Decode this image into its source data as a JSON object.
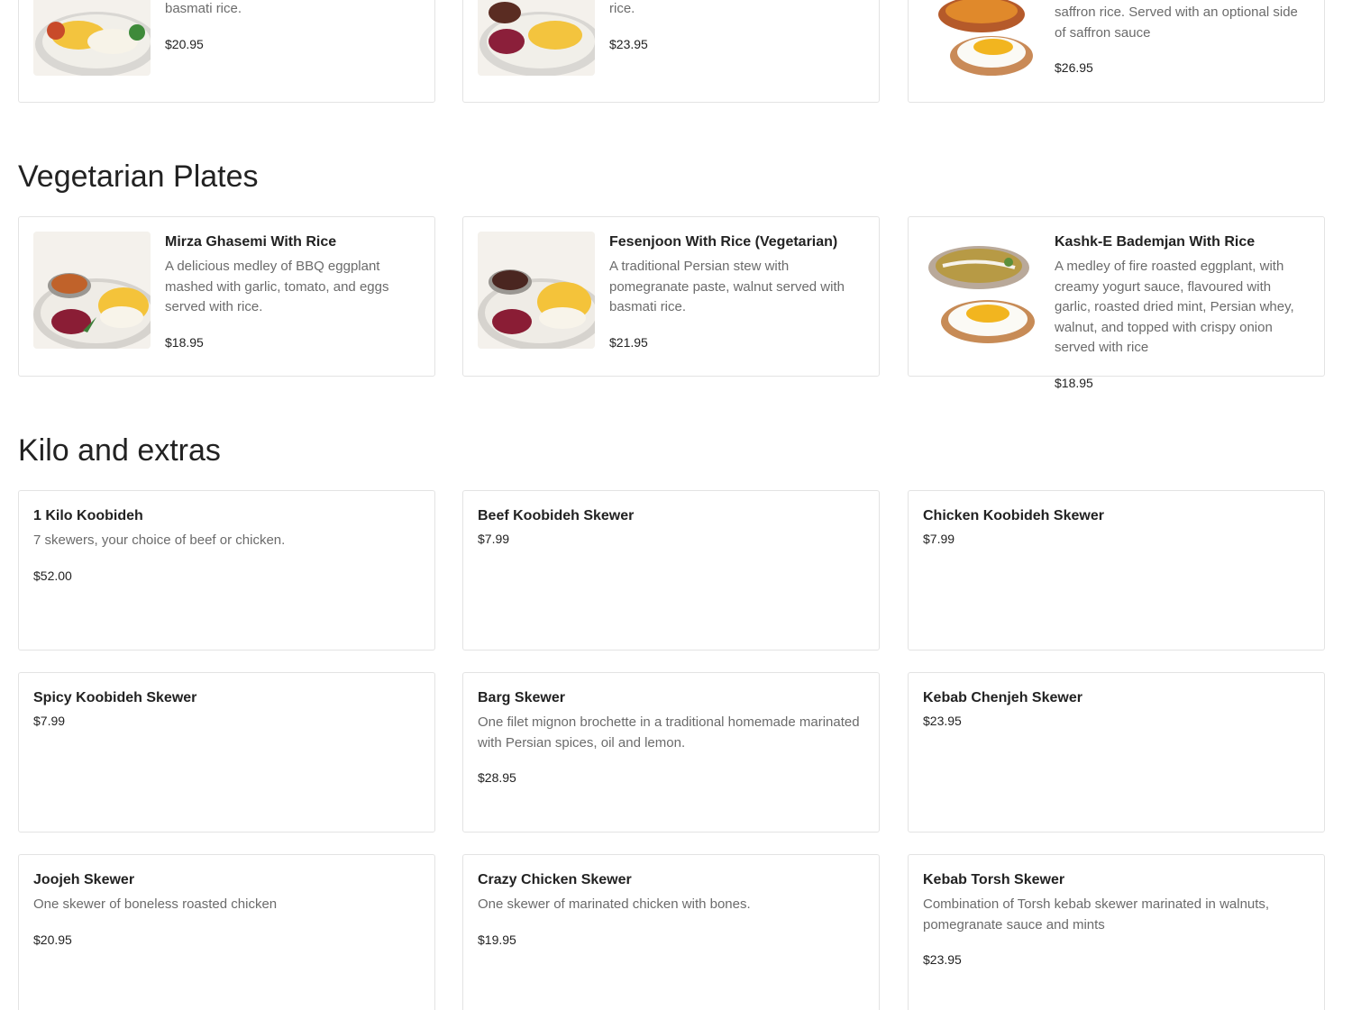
{
  "top_row": [
    {
      "desc": "basmati rice.",
      "price": "$20.95"
    },
    {
      "desc": "pomegranate paste, walnut and in-bone chicken thighs pieces served with basmati rice.",
      "price": "$23.95"
    },
    {
      "desc": "saffron rice. Served with an optional side of saffron sauce",
      "price": "$26.95"
    }
  ],
  "vegetarian": {
    "title": "Vegetarian Plates",
    "items": [
      {
        "name": "Mirza Ghasemi With Rice",
        "desc": "A delicious medley of BBQ eggplant mashed with garlic, tomato, and eggs served with rice.",
        "price": "$18.95",
        "image": "mirza-ghasemi-plate"
      },
      {
        "name": "Fesenjoon With Rice (Vegetarian)",
        "desc": "A traditional Persian stew with pomegranate paste, walnut served with basmati rice.",
        "price": "$21.95",
        "image": "fesenjoon-plate"
      },
      {
        "name": "Kashk-E Bademjan With Rice",
        "desc": "A medley of fire roasted eggplant, with creamy yogurt sauce, flavoured with garlic, roasted dried mint, Persian whey, walnut, and topped with crispy onion served with rice",
        "price": "$18.95",
        "image": "kashk-e-bademjan-plate"
      }
    ]
  },
  "kilo": {
    "title": "Kilo and extras",
    "items": [
      {
        "name": "1 Kilo Koobideh",
        "desc": "7 skewers, your choice of beef or chicken.",
        "price": "$52.00"
      },
      {
        "name": "Beef Koobideh Skewer",
        "desc": "",
        "price": "$7.99"
      },
      {
        "name": "Chicken Koobideh Skewer",
        "desc": "",
        "price": "$7.99"
      },
      {
        "name": "Spicy Koobideh Skewer",
        "desc": "",
        "price": "$7.99"
      },
      {
        "name": "Barg Skewer",
        "desc": "One filet mignon brochette in a traditional homemade marinated with Persian spices, oil and lemon.",
        "price": "$28.95"
      },
      {
        "name": "Kebab Chenjeh Skewer",
        "desc": "",
        "price": "$23.95"
      },
      {
        "name": "Joojeh Skewer",
        "desc": "One skewer of boneless roasted chicken",
        "price": "$20.95"
      },
      {
        "name": "Crazy Chicken Skewer",
        "desc": "One skewer of marinated chicken with bones.",
        "price": "$19.95"
      },
      {
        "name": "Kebab Torsh Skewer",
        "desc": "Combination of Torsh kebab skewer marinated in walnuts, pomegranate sauce and mints",
        "price": "$23.95"
      }
    ]
  }
}
